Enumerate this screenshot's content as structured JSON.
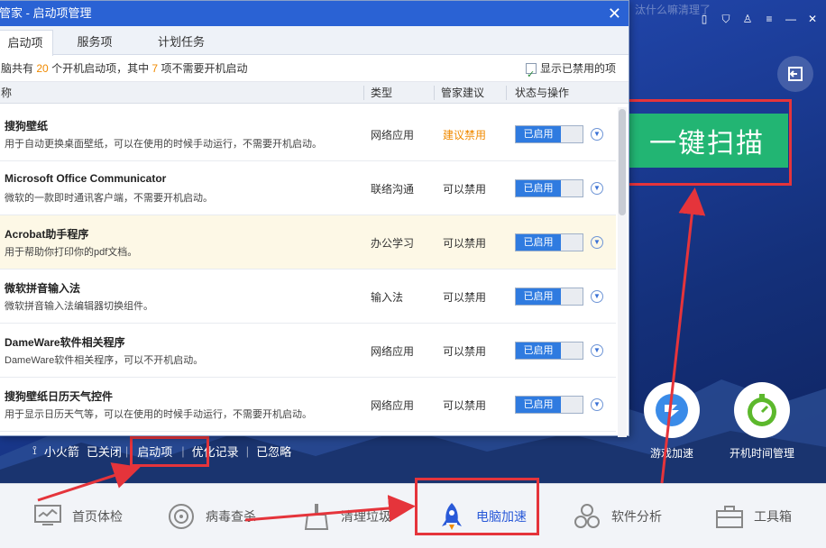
{
  "dialog": {
    "title": "管家 - 启动项管理",
    "close": "✕",
    "tabs": [
      "启动项",
      "服务项",
      "计划任务"
    ],
    "info": {
      "prefix": "脑共有",
      "total": "20",
      "mid": "个开机启动项，其中",
      "unneeded": "7",
      "suffix": "项不需要开机启动"
    },
    "show_disabled": "显示已禁用的项",
    "columns": {
      "name": "称",
      "type": "类型",
      "advice": "管家建议",
      "status": "状态与操作"
    },
    "rows": [
      {
        "name": "搜狗壁纸",
        "desc": "用于自动更换桌面壁纸，可以在使用的时候手动运行，不需要开机启动。",
        "type": "网络应用",
        "advice": "建议禁用",
        "status": "已启用"
      },
      {
        "name": "Microsoft Office Communicator",
        "desc": "微软的一款即时通讯客户端，不需要开机启动。",
        "type": "联络沟通",
        "advice": "可以禁用",
        "status": "已启用"
      },
      {
        "name": "Acrobat助手程序",
        "desc": "用于帮助你打印你的pdf文档。",
        "type": "办公学习",
        "advice": "可以禁用",
        "status": "已启用"
      },
      {
        "name": "微软拼音输入法",
        "desc": "微软拼音输入法编辑器切换组件。",
        "type": "输入法",
        "advice": "可以禁用",
        "status": "已启用"
      },
      {
        "name": "DameWare软件相关程序",
        "desc": "DameWare软件相关程序，可以不开机启动。",
        "type": "网络应用",
        "advice": "可以禁用",
        "status": "已启用"
      },
      {
        "name": "搜狗壁纸日历天气控件",
        "desc": "用于显示日历天气等，可以在使用的时候手动运行，不需要开机启动。",
        "type": "网络应用",
        "advice": "可以禁用",
        "status": "已启用"
      }
    ]
  },
  "app": {
    "topbar_faint": "汰什么嘛清理了",
    "scan_button": "一键扫描",
    "tools": [
      {
        "label": "游戏加速",
        "icon": "game-boost-icon"
      },
      {
        "label": "开机时间管理",
        "icon": "stopwatch-icon"
      }
    ],
    "status_strip": {
      "rocket": "小火箭",
      "closed": "已关闭",
      "startup": "启动项",
      "optimize": "优化记录",
      "ignored": "已忽略"
    },
    "nav": [
      {
        "label": "首页体检",
        "icon": "monitor-check-icon"
      },
      {
        "label": "病毒查杀",
        "icon": "virus-scan-icon"
      },
      {
        "label": "清理垃圾",
        "icon": "broom-icon"
      },
      {
        "label": "电脑加速",
        "icon": "rocket-icon",
        "active": true
      },
      {
        "label": "软件分析",
        "icon": "fan-icon"
      },
      {
        "label": "工具箱",
        "icon": "toolbox-icon"
      }
    ]
  },
  "colors": {
    "accent": "#2a62d4",
    "scan_green": "#22b573",
    "annotation_red": "#e5343b",
    "warn_orange": "#f08a00"
  }
}
